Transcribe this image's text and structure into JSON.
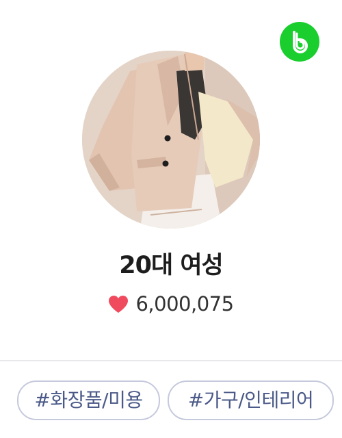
{
  "card": {
    "brand_icon": "blog-b-icon",
    "avatar_description_icon": "profile-photo",
    "title": "20대 여성",
    "likes": {
      "icon": "heart-icon",
      "count": "6,000,075"
    },
    "tags": [
      {
        "label": "#화장품/미용"
      },
      {
        "label": "#가구/인테리어"
      }
    ]
  },
  "colors": {
    "brand_green": "#19ce2d",
    "heart_red": "#f04a5e",
    "tag_text": "#4a5988",
    "tag_border": "#c4c9dc",
    "title_text": "#1d1d1d"
  }
}
